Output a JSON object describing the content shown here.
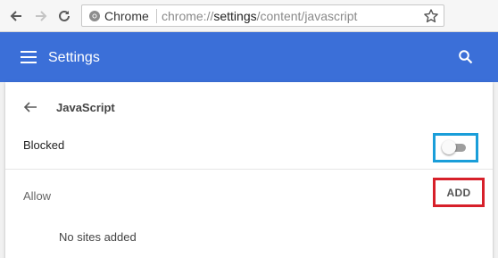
{
  "browser": {
    "site_chip": "Chrome",
    "url_scheme": "chrome://",
    "url_host": "settings",
    "url_path": "/content/javascript",
    "icons": [
      "back-arrow-icon",
      "forward-arrow-icon",
      "reload-icon",
      "chrome-logo-icon",
      "bookmark-star-icon"
    ]
  },
  "header": {
    "title": "Settings",
    "icons": [
      "hamburger-menu-icon",
      "search-icon"
    ]
  },
  "content": {
    "section_title": "JavaScript",
    "blocked_label": "Blocked",
    "toggle_state": "off",
    "allow_label": "Allow",
    "add_label": "ADD",
    "empty_text": "No sites added"
  },
  "colors": {
    "header_blue": "#3b6fd8",
    "toggle_highlight": "#1a9ed9",
    "add_highlight": "#d7202a"
  }
}
